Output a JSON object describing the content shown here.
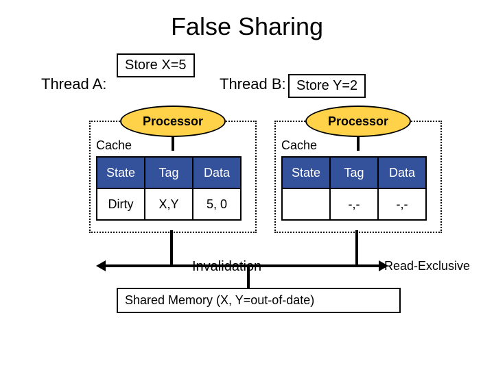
{
  "title": "False Sharing",
  "threads": {
    "a": "Thread A:",
    "b": "Thread B:"
  },
  "stores": {
    "a": "Store X=5",
    "b": "Store Y=2"
  },
  "processor_label": "Processor",
  "cache_label": "Cache",
  "cache_headers": {
    "state": "State",
    "tag": "Tag",
    "data": "Data"
  },
  "cache_rows": {
    "left": {
      "state": "Dirty",
      "tag": "X,Y",
      "data": "5, 0"
    },
    "right": {
      "state": "",
      "tag": "-,-",
      "data": "-,-"
    }
  },
  "invalidation_label": "Invalidation",
  "read_exclusive_label": "Read-Exclusive",
  "shared_memory_label": "Shared Memory (X, Y=out-of-date)"
}
